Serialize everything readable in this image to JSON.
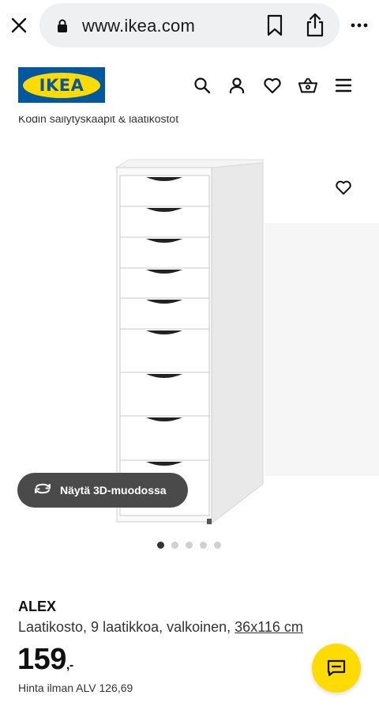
{
  "browser": {
    "url": "www.ikea.com",
    "icons": [
      "close-icon",
      "lock-icon",
      "bookmark-icon",
      "share-icon",
      "more-icon"
    ]
  },
  "header": {
    "logo_text": "IKEA",
    "icons": [
      "search-icon",
      "account-icon",
      "heart-icon",
      "cart-icon",
      "menu-icon"
    ]
  },
  "breadcrumb": "Kodin säilytyskaapit & laatikostot",
  "gallery": {
    "view_3d_label": "Näytä 3D-muodossa",
    "image_count": 5,
    "active_index": 0
  },
  "product": {
    "name": "ALEX",
    "description": "Laatikosto, 9 laatikkoa, valkoinen, ",
    "dimensions": "36x116 cm",
    "price_integer": "159",
    "price_suffix": ",-",
    "price_ex_vat": "Hinta ilman ALV 126,69"
  },
  "colors": {
    "ikea_blue": "#0058a3",
    "ikea_yellow": "#ffdb00",
    "button_dark": "#4a4a4a"
  }
}
